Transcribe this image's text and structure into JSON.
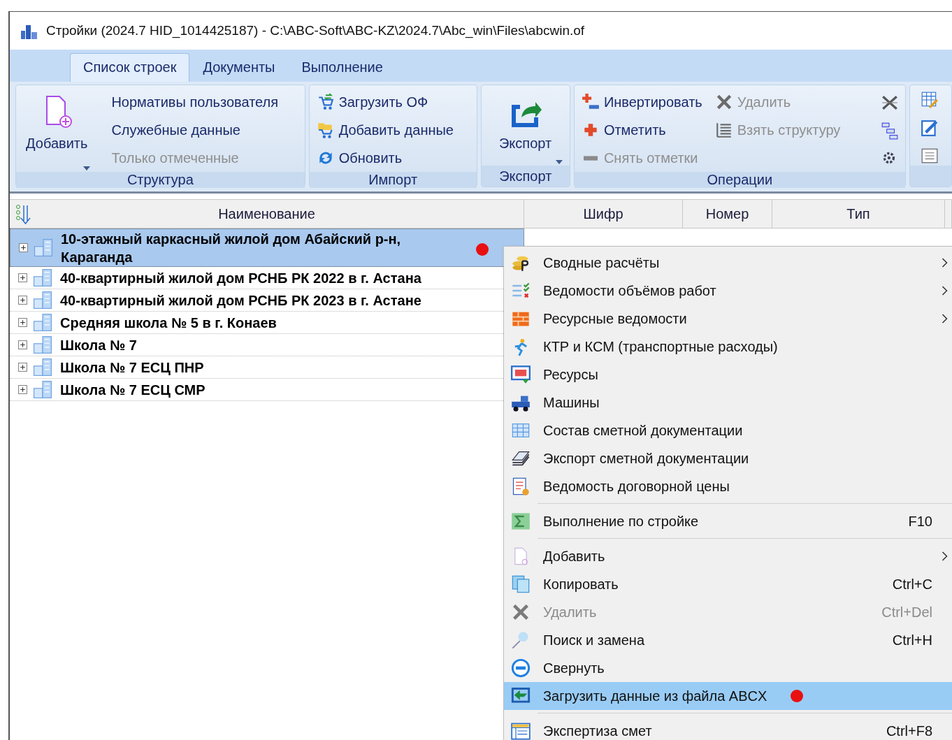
{
  "window": {
    "title": "Стройки (2024.7 HID_1014425187) - C:\\ABC-Soft\\ABC-KZ\\2024.7\\Abc_win\\Files\\abcwin.of"
  },
  "tabs": [
    {
      "label": "Список строек",
      "selected": true
    },
    {
      "label": "Документы",
      "selected": false
    },
    {
      "label": "Выполнение",
      "selected": false
    }
  ],
  "ribbon": {
    "groups": [
      {
        "label": "Структура",
        "large_button": {
          "label": "Добавить",
          "dropdown": true
        },
        "columns": [
          [
            {
              "label": "Нормативы пользователя",
              "disabled": false
            },
            {
              "label": "Служебные данные",
              "disabled": false
            },
            {
              "label": "Только отмеченные",
              "disabled": true
            }
          ]
        ]
      },
      {
        "label": "Импорт",
        "columns": [
          [
            {
              "label": "Загрузить ОФ",
              "disabled": false
            },
            {
              "label": "Добавить данные",
              "disabled": false
            },
            {
              "label": "Обновить",
              "disabled": false
            }
          ]
        ]
      },
      {
        "label": "Экспорт",
        "large_button": {
          "label": "Экспорт",
          "dropdown": true
        }
      },
      {
        "label": "Операции",
        "columns": [
          [
            {
              "label": "Инвертировать",
              "disabled": false
            },
            {
              "label": "Отметить",
              "disabled": false
            },
            {
              "label": "Снять отметки",
              "disabled": true
            }
          ],
          [
            {
              "label": "Удалить",
              "disabled": true
            },
            {
              "label": "Взять структуру",
              "disabled": true
            }
          ]
        ]
      }
    ]
  },
  "table": {
    "columns": [
      "Наименование",
      "Шифр",
      "Номер",
      "Тип"
    ],
    "rows": [
      {
        "name": "10-этажный каркасный жилой дом Абайский р-н, Караганда",
        "selected": true,
        "expanded": false,
        "red_dot": true
      },
      {
        "name": "40-квартирный жилой дом РСНБ РК 2022 в г. Астана",
        "selected": false,
        "expanded": false,
        "red_dot": false
      },
      {
        "name": "40-квартирный жилой дом РСНБ РК 2023 в г. Астане",
        "selected": false,
        "expanded": false,
        "red_dot": false
      },
      {
        "name": "Средняя школа № 5 в г. Конаев",
        "selected": false,
        "expanded": false,
        "red_dot": false
      },
      {
        "name": "Школа № 7",
        "selected": false,
        "expanded": false,
        "red_dot": false
      },
      {
        "name": "Школа № 7 ЕСЦ ПНР",
        "selected": false,
        "expanded": false,
        "red_dot": false
      },
      {
        "name": "Школа № 7 ЕСЦ СМР",
        "selected": false,
        "expanded": false,
        "red_dot": false
      }
    ]
  },
  "context_menu": {
    "items": [
      {
        "kind": "item",
        "label": "Сводные расчёты",
        "submenu": true,
        "disabled": false,
        "selected": false,
        "red_dot": false
      },
      {
        "kind": "item",
        "label": "Ведомости объёмов работ",
        "submenu": true,
        "disabled": false,
        "selected": false,
        "red_dot": false
      },
      {
        "kind": "item",
        "label": "Ресурсные ведомости",
        "submenu": true,
        "disabled": false,
        "selected": false,
        "red_dot": false
      },
      {
        "kind": "item",
        "label": "КТР и КСМ (транспортные расходы)",
        "submenu": false,
        "disabled": false,
        "selected": false,
        "red_dot": false
      },
      {
        "kind": "item",
        "label": "Ресурсы",
        "submenu": false,
        "disabled": false,
        "selected": false,
        "red_dot": false
      },
      {
        "kind": "item",
        "label": "Машины",
        "submenu": false,
        "disabled": false,
        "selected": false,
        "red_dot": false
      },
      {
        "kind": "item",
        "label": "Состав сметной документации",
        "submenu": false,
        "disabled": false,
        "selected": false,
        "red_dot": false
      },
      {
        "kind": "item",
        "label": "Экспорт сметной документации",
        "submenu": false,
        "disabled": false,
        "selected": false,
        "red_dot": false
      },
      {
        "kind": "item",
        "label": "Ведомость договорной цены",
        "submenu": false,
        "disabled": false,
        "selected": false,
        "red_dot": false
      },
      {
        "kind": "separator"
      },
      {
        "kind": "item",
        "label": "Выполнение по стройке",
        "shortcut": "F10",
        "submenu": false,
        "disabled": false,
        "selected": false,
        "red_dot": false
      },
      {
        "kind": "separator"
      },
      {
        "kind": "item",
        "label": "Добавить",
        "submenu": true,
        "disabled": false,
        "selected": false,
        "red_dot": false
      },
      {
        "kind": "item",
        "label": "Копировать",
        "shortcut": "Ctrl+C",
        "submenu": false,
        "disabled": false,
        "selected": false,
        "red_dot": false
      },
      {
        "kind": "item",
        "label": "Удалить",
        "shortcut": "Ctrl+Del",
        "submenu": false,
        "disabled": true,
        "selected": false,
        "red_dot": false
      },
      {
        "kind": "item",
        "label": "Поиск и замена",
        "shortcut": "Ctrl+H",
        "submenu": false,
        "disabled": false,
        "selected": false,
        "red_dot": false
      },
      {
        "kind": "item",
        "label": "Свернуть",
        "submenu": false,
        "disabled": false,
        "selected": false,
        "red_dot": false
      },
      {
        "kind": "item",
        "label": "Загрузить данные из файла ABCX",
        "submenu": false,
        "disabled": false,
        "selected": true,
        "red_dot": true
      },
      {
        "kind": "separator"
      },
      {
        "kind": "item",
        "label": "Экспертиза смет",
        "shortcut": "Ctrl+F8",
        "submenu": false,
        "disabled": false,
        "selected": false,
        "red_dot": false
      }
    ]
  }
}
